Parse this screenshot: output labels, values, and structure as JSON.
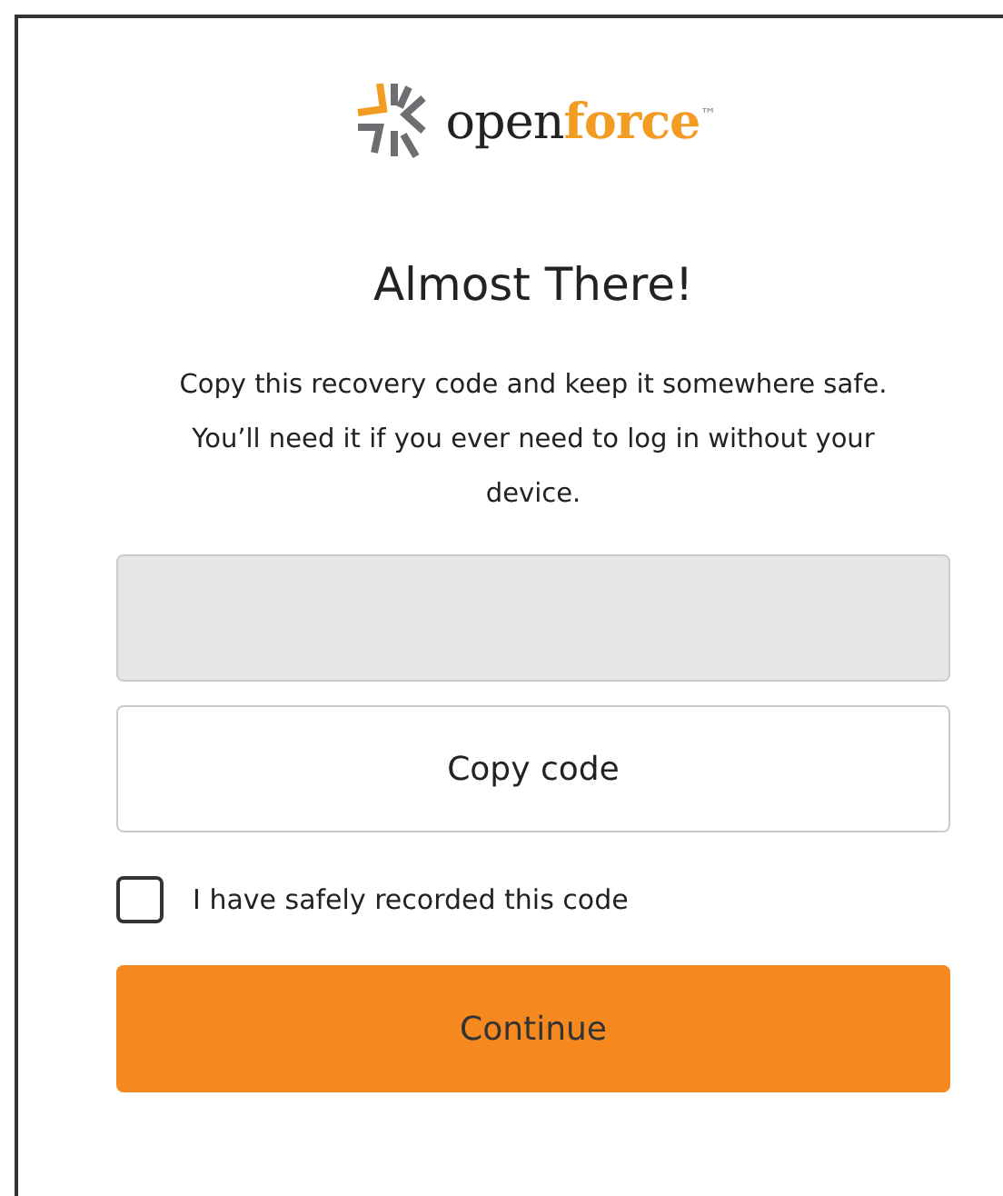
{
  "logo": {
    "text": "open**force**$^{™}$"
  },
  "title": "Almost There!",
  "message": "Copy this recovery code and keep it somewhere safe. You’ll need it if you ever need to log in without your device.",
  "code_field": {
    "disabled": true
  },
  "copy_button": "Copy code",
  "confirm": {
    "label": "I have safely recorded this code",
    "checked": false
  },
  "continue_button": "Continue"
}
